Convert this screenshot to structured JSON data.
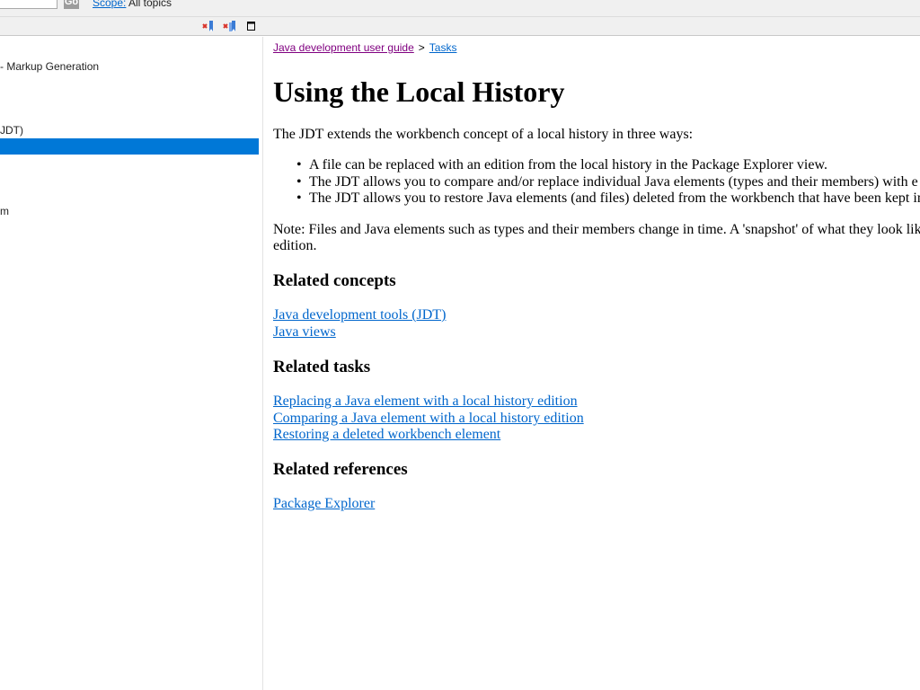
{
  "search": {
    "go_label": "Go",
    "scope_label": "Scope:",
    "scope_value": "All topics"
  },
  "toolbar": {
    "icons": [
      "remove-bookmark-icon",
      "remove-all-bookmarks-icon",
      "maximize-icon"
    ]
  },
  "nav": {
    "items": [
      " - Markup Generation",
      "JDT)",
      "",
      "m"
    ],
    "selected_index": 2,
    "selected_color": "#0078d7"
  },
  "content": {
    "breadcrumb": {
      "parent": "Java development user guide",
      "separator": ">",
      "current": "Tasks"
    },
    "title": "Using the Local History",
    "intro": "The JDT extends the workbench concept of a local history in three ways:",
    "bullets": [
      "A file can be replaced with an edition from the local history in the Package Explorer view.",
      "The JDT allows you to compare and/or replace individual Java elements (types and their members) with e",
      "The JDT allows you to restore Java elements (and files) deleted from the workbench that have been kept in"
    ],
    "note_line1": "Note: Files and Java elements such as types and their members change in time. A 'snapshot' of what they look lik",
    "note_line2": "edition.",
    "related_concepts": {
      "heading": "Related concepts",
      "links": [
        "Java development tools (JDT)",
        "Java views"
      ]
    },
    "related_tasks": {
      "heading": "Related tasks",
      "links": [
        "Replacing a Java element with a local history edition",
        "Comparing a Java element with a local history edition",
        "Restoring a deleted workbench element"
      ]
    },
    "related_references": {
      "heading": "Related references",
      "links": [
        "Package Explorer"
      ]
    }
  },
  "colors": {
    "link": "#0066cc",
    "visited_link": "#800080",
    "selection": "#0078d7"
  }
}
